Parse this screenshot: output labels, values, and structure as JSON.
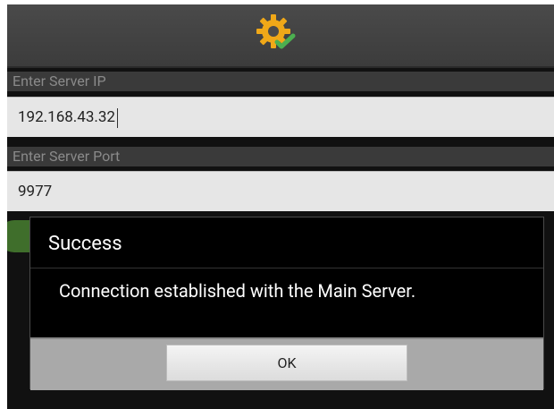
{
  "header": {
    "icon": "settings-gear-icon"
  },
  "fields": {
    "server_ip_label": "Enter Server IP",
    "server_ip_value": "192.168.43.32",
    "server_port_label": "Enter Server Port",
    "server_port_value": "9977"
  },
  "dialog": {
    "title": "Success",
    "message": "Connection established with the Main Server.",
    "ok_label": "OK"
  },
  "colors": {
    "gear": "#f0a818",
    "check": "#4caf50",
    "dialog_bg": "#000000",
    "footer_bg": "#a9a9a9"
  }
}
